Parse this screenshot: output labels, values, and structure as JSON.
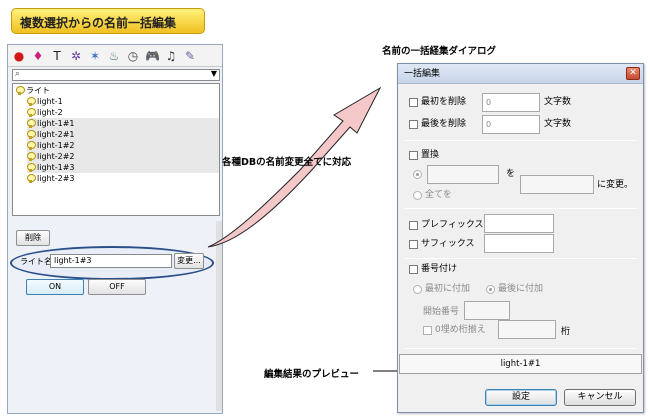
{
  "banner": {
    "title": "複数選択からの名前一括編集"
  },
  "left_panel": {
    "toolbar_icons": [
      "red-ball-icon",
      "object-icon",
      "text-icon",
      "figure-icon",
      "effect-icon",
      "gauge-icon",
      "clock-icon",
      "gamepad-icon",
      "music-icon",
      "note-icon"
    ],
    "toolbar_glyphs": [
      "●",
      "♦",
      "T",
      "✲",
      "✶",
      "♨",
      "◷",
      "🎮",
      "♫",
      "✎"
    ],
    "tree": [
      {
        "label": "ライト",
        "indent": 0,
        "selected": false,
        "root": true
      },
      {
        "label": "light-1",
        "indent": 1,
        "selected": false
      },
      {
        "label": "light-2",
        "indent": 1,
        "selected": false
      },
      {
        "label": "light-1#1",
        "indent": 1,
        "selected": true
      },
      {
        "label": "light-2#1",
        "indent": 1,
        "selected": true
      },
      {
        "label": "light-1#2",
        "indent": 1,
        "selected": true
      },
      {
        "label": "light-2#2",
        "indent": 1,
        "selected": true
      },
      {
        "label": "light-1#3",
        "indent": 1,
        "selected": true
      },
      {
        "label": "light-2#3",
        "indent": 1,
        "selected": false
      }
    ],
    "delete_button": "削除",
    "name_label": "ライト名",
    "name_value": "light-1#3",
    "change_button": "変更...",
    "on_button": "ON",
    "off_button": "OFF"
  },
  "callouts": {
    "dialog_title": "名前の一括経集ダイアログ",
    "all_db": "各種DBの名前変更全てに対応",
    "preview": "編集結果のプレビュー"
  },
  "dialog": {
    "title": "一括編集",
    "close_glyph": "✕",
    "delete_first": "最初を削除",
    "delete_first_value": "0",
    "delete_last": "最後を削除",
    "delete_last_value": "0",
    "chars": "文字数",
    "replace": "置換",
    "to_particle": "を",
    "change_to": "に変更。",
    "all": "全てを",
    "prefix": "プレフィックス",
    "suffix": "サフィックス",
    "numbering": "番号付け",
    "add_first": "最初に付加",
    "add_last": "最後に付加",
    "start_number": "開始番号",
    "zero_pad": "0埋め桁揃え",
    "digits": "桁",
    "preview_value": "light-1#1",
    "ok": "設定",
    "cancel": "キャンセル"
  }
}
